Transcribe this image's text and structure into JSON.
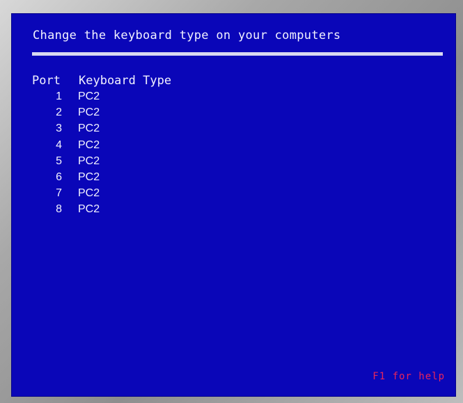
{
  "screen": {
    "title": "Change the keyboard type on your computers",
    "table": {
      "headers": {
        "port": "Port",
        "keyboard_type": "Keyboard Type"
      },
      "rows": [
        {
          "port": "1",
          "keyboard_type": "PC2"
        },
        {
          "port": "2",
          "keyboard_type": "PC2"
        },
        {
          "port": "3",
          "keyboard_type": "PC2"
        },
        {
          "port": "4",
          "keyboard_type": "PC2"
        },
        {
          "port": "5",
          "keyboard_type": "PC2"
        },
        {
          "port": "6",
          "keyboard_type": "PC2"
        },
        {
          "port": "7",
          "keyboard_type": "PC2"
        },
        {
          "port": "8",
          "keyboard_type": "PC2"
        }
      ]
    },
    "help_hint": "F1 for help"
  },
  "colors": {
    "background": "#0a06b8",
    "text": "#f2f2ff",
    "help_text": "#e8245c",
    "frame": "#a8a8a8"
  }
}
